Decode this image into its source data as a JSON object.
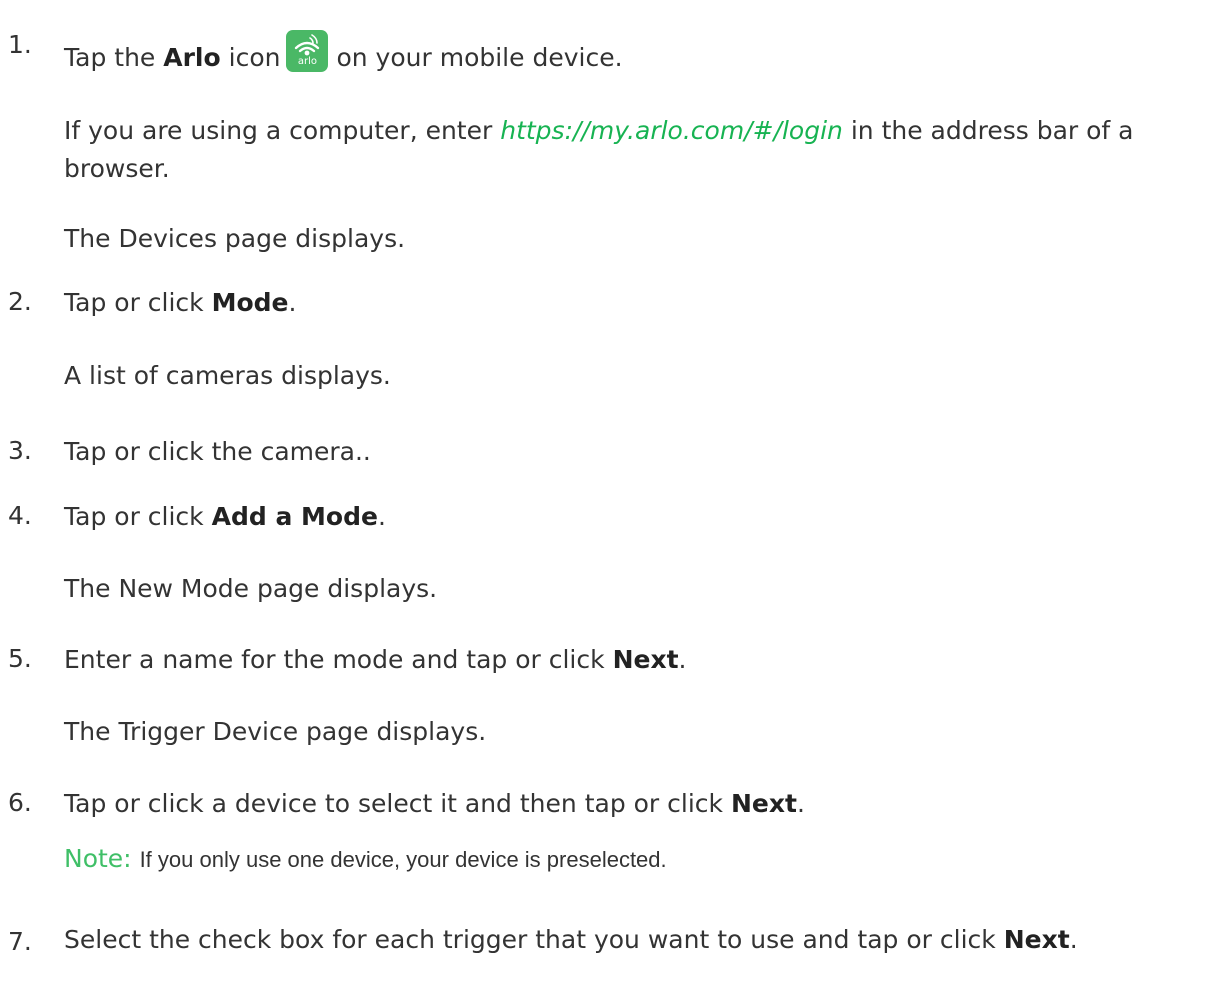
{
  "steps": [
    {
      "number": "1.",
      "text_before": "Tap the",
      "bold": "Arlo",
      "text_after_bold": "icon",
      "icon": "arlo-app-icon",
      "icon_text": "arlo",
      "text_end": "on your mobile device.",
      "sub1_before": "If you are using a computer, enter",
      "sub1_link": "https://my.arlo.com/#/login",
      "sub1_after": "in the address bar of a browser.",
      "sub2": "The Devices page displays."
    },
    {
      "number": "2.",
      "text_before": "Tap or click",
      "bold": "Mode",
      "text_after": ".",
      "sub": "A list of cameras displays."
    },
    {
      "number": "3.",
      "text": "Tap or click the camera.."
    },
    {
      "number": "4.",
      "text_before": "Tap or click",
      "bold": "Add a Mode",
      "text_after": ".",
      "sub": "The New Mode page displays."
    },
    {
      "number": "5.",
      "text_before": "Enter a name for the mode and tap or click",
      "bold": "Next",
      "text_after": ".",
      "sub": "The Trigger Device page displays."
    },
    {
      "number": "6.",
      "text_before": "Tap or click a device to select it and then tap or click",
      "bold": "Next",
      "text_after": ".",
      "note_label": "Note:",
      "note_text": "If you only use one device, your device is preselected."
    },
    {
      "number": "7.",
      "text": "Select the check box for each trigger that you want to use and tap or click",
      "bold": "Next",
      "text_after": "."
    }
  ],
  "colors": {
    "link": "#17b352",
    "note": "#3fbf67",
    "icon_bg": "#4ab866",
    "text": "#333333"
  }
}
